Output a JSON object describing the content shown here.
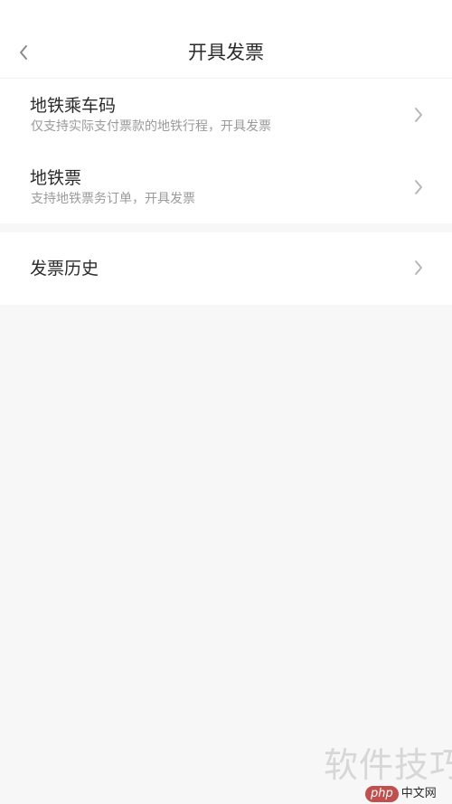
{
  "header": {
    "title": "开具发票"
  },
  "sections": [
    {
      "rows": [
        {
          "title": "地铁乘车码",
          "subtitle": "仅支持实际支付票款的地铁行程，开具发票"
        },
        {
          "title": "地铁票",
          "subtitle": "支持地铁票务订单，开具发票"
        }
      ]
    },
    {
      "rows": [
        {
          "title": "发票历史"
        }
      ]
    }
  ],
  "watermark": {
    "text": "软件技巧",
    "badge": "php",
    "site": "中文网"
  },
  "colors": {
    "background": "#f7f7f7",
    "card": "#ffffff",
    "title_text": "#2b2b2b",
    "subtitle_text": "#9a9a9a",
    "chevron": "#b3b3b3"
  }
}
